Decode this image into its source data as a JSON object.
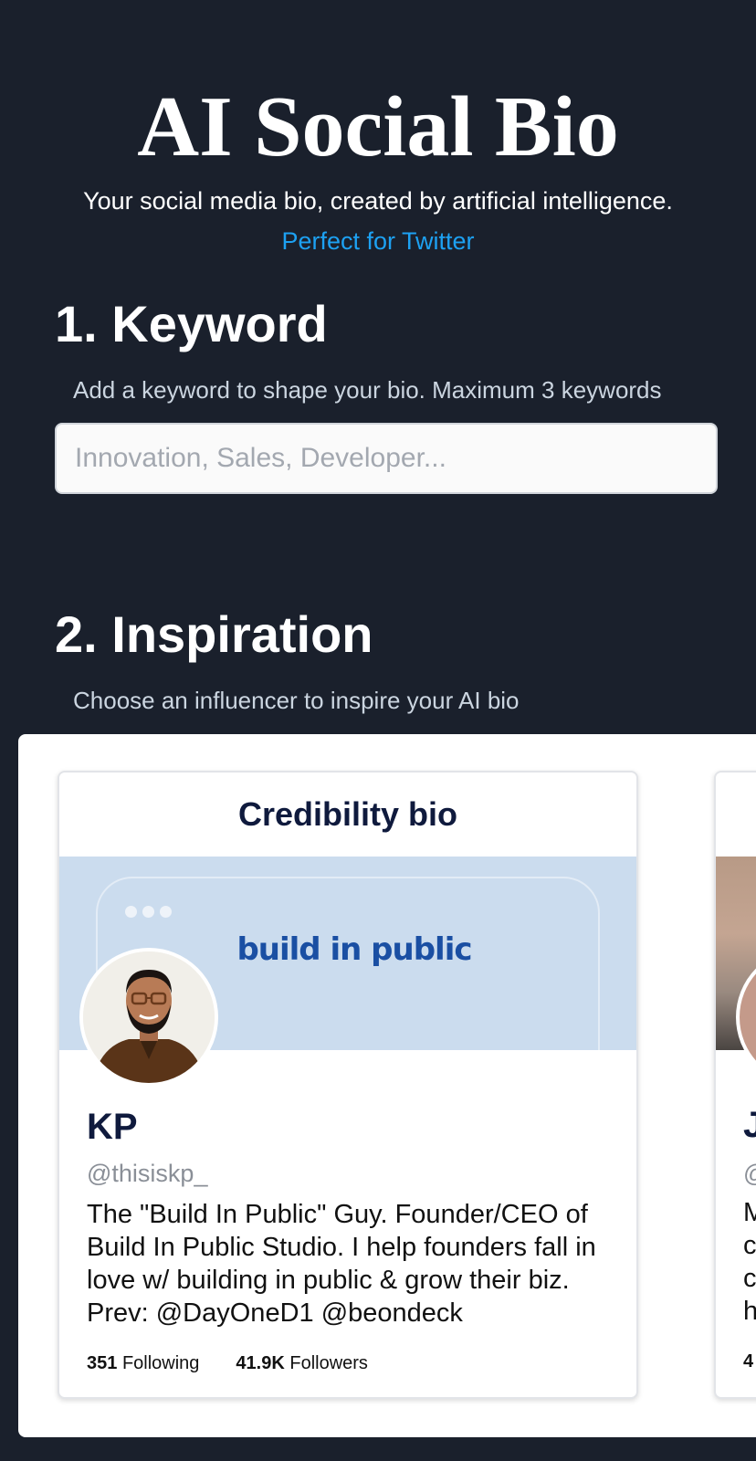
{
  "header": {
    "title": "AI Social Bio",
    "tagline": "Your social media bio, created by artificial intelligence.",
    "platform_link": "Perfect for Twitter"
  },
  "keyword_section": {
    "heading": "1. Keyword",
    "hint": "Add a keyword to shape your bio. Maximum 3 keywords",
    "input_placeholder": "Innovation, Sales, Developer...",
    "input_value": ""
  },
  "inspiration_section": {
    "heading": "2. Inspiration",
    "hint": "Choose an influencer to inspire your AI bio"
  },
  "cards": [
    {
      "title": "Credibility bio",
      "banner_text": "build in public",
      "name": "KP",
      "handle": "@thisiskp_",
      "bio": "The \"Build In Public\" Guy. Founder/CEO of Build In Public Studio. I help founders fall in love w/ building in public & grow their biz. Prev: @DayOneD1 @beondeck",
      "following_count": "351",
      "following_label": "Following",
      "followers_count": "41.9K",
      "followers_label": "Followers"
    },
    {
      "name_partial": "J",
      "handle_partial": "@",
      "bio_partial": [
        "M",
        "c",
        "c",
        "h"
      ],
      "count_partial": "4"
    }
  ],
  "colors": {
    "background": "#1a202c",
    "accent_link": "#1da1f2",
    "card_title": "#0f1a3d",
    "banner_bg": "#cbdcee",
    "banner_text": "#1a4fa3"
  }
}
